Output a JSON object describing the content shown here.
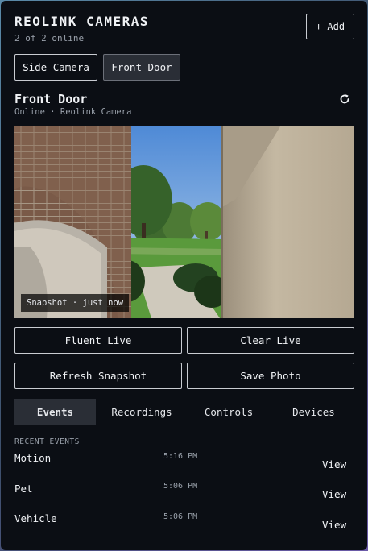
{
  "header": {
    "title": "REOLINK CAMERAS",
    "subtitle": "2 of 2 online",
    "add_label": "+ Add"
  },
  "camera_tabs": [
    {
      "label": "Side Camera",
      "active": false
    },
    {
      "label": "Front Door",
      "active": true
    }
  ],
  "camera": {
    "name": "Front Door",
    "meta": "Online · Reolink Camera",
    "refresh_icon": "refresh-icon",
    "snapshot_badge": "Snapshot · just now"
  },
  "actions": {
    "fluent_live": "Fluent Live",
    "clear_live": "Clear Live",
    "refresh_snapshot": "Refresh Snapshot",
    "save_photo": "Save Photo"
  },
  "nav_tabs": [
    {
      "label": "Events",
      "active": true
    },
    {
      "label": "Recordings",
      "active": false
    },
    {
      "label": "Controls",
      "active": false
    },
    {
      "label": "Devices",
      "active": false
    }
  ],
  "events": {
    "section_label": "RECENT EVENTS",
    "items": [
      {
        "type": "Motion",
        "time": "5:16 PM",
        "action": "View"
      },
      {
        "type": "Pet",
        "time": "5:06 PM",
        "action": "View"
      },
      {
        "type": "Vehicle",
        "time": "5:06 PM",
        "action": "View"
      }
    ]
  },
  "colors": {
    "background": "#0b0e14",
    "panel_active": "#2a2e36",
    "border": "#c9ccd2",
    "text": "#f0f2f5",
    "muted": "#9aa1ab"
  }
}
